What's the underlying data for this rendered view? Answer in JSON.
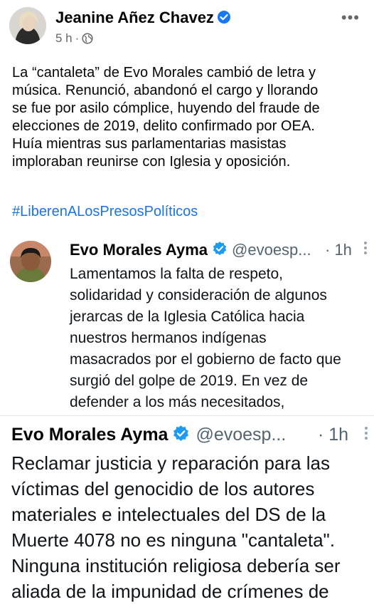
{
  "post": {
    "author": "Jeanine Añez Chavez",
    "timestamp": "5 h",
    "separator": "·",
    "more": "•••",
    "text_lines": [
      "La “cantaleta” de Evo Morales cambió de letra y",
      "música. Renunció, abandonó el cargo y llorando",
      "se fue por asilo cómplice, huyendo del fraude de",
      "elecciones de 2019, delito confirmado por OEA.",
      "Huía mientras sus parlamentarias masistas",
      "imploraban reunirse con Iglesia y oposición."
    ],
    "hashtag": "#LiberenALosPresosPolíticos"
  },
  "tweet1": {
    "name": "Evo Morales Ayma",
    "handle": "@evoesp...",
    "time": "· 1h",
    "more": "⋮",
    "lines": [
      "Lamentamos la falta de respeto,",
      "solidaridad y consideración de algunos",
      "jerarcas de la Iglesia Católica hacia",
      "nuestros hermanos indígenas",
      "masacrados por el gobierno de facto que",
      "surgió del golpe de 2019. En vez de",
      "defender a los más necesitados,"
    ]
  },
  "tweet2": {
    "name": "Evo Morales Ayma",
    "handle": "@evoesp...",
    "time": "· 1h",
    "more": "⋮",
    "lines": [
      "Reclamar justicia y reparación para las",
      "víctimas del genocidio de los autores",
      "materiales e intelectuales del DS de la",
      "Muerte 4078 no es ninguna \"cantaleta\".",
      "Ninguna institución religiosa debería ser",
      "aliada de la impunidad de crímenes de"
    ]
  },
  "colors": {
    "verified": "#1d9bf0",
    "hashtag": "#1b74e4",
    "secondary": "#65676b"
  },
  "icons": {
    "verified": "verified-badge-icon",
    "globe": "globe-icon",
    "more": "more-options-icon"
  }
}
